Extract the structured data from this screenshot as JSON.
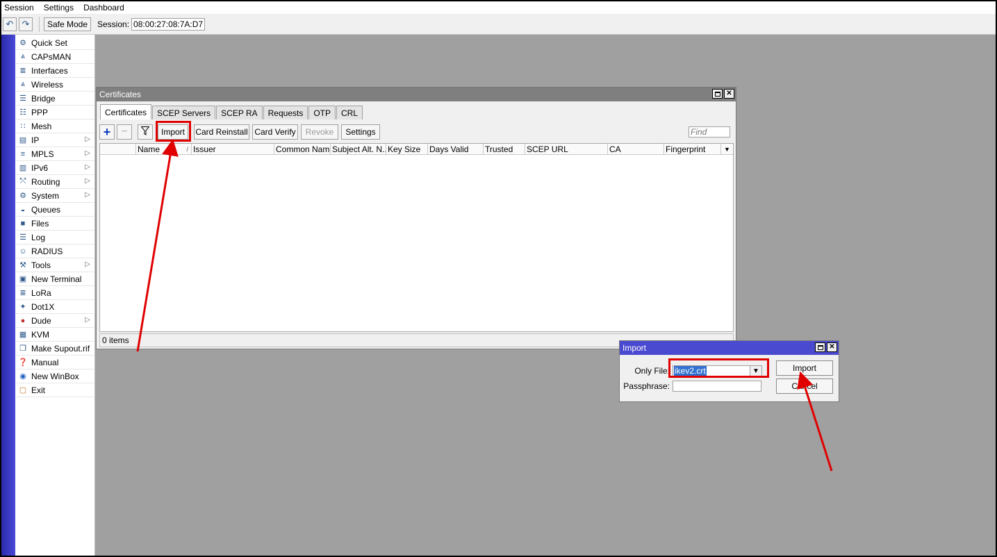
{
  "menubar": [
    "Session",
    "Settings",
    "Dashboard"
  ],
  "toolbar": {
    "undo_icon": "undo-icon",
    "redo_icon": "redo-icon",
    "safe_mode": "Safe Mode",
    "session_label": "Session:",
    "session_value": "08:00:27:08:7A:D7"
  },
  "leftmenu": [
    {
      "label": "Quick Set",
      "icon": "quick-set-icon",
      "submenu": false
    },
    {
      "label": "CAPsMAN",
      "icon": "capsman-icon",
      "submenu": false
    },
    {
      "label": "Interfaces",
      "icon": "interfaces-icon",
      "submenu": false
    },
    {
      "label": "Wireless",
      "icon": "wireless-icon",
      "submenu": false
    },
    {
      "label": "Bridge",
      "icon": "bridge-icon",
      "submenu": false
    },
    {
      "label": "PPP",
      "icon": "ppp-icon",
      "submenu": false
    },
    {
      "label": "Mesh",
      "icon": "mesh-icon",
      "submenu": false
    },
    {
      "label": "IP",
      "icon": "ip-icon",
      "submenu": true
    },
    {
      "label": "MPLS",
      "icon": "mpls-icon",
      "submenu": true
    },
    {
      "label": "IPv6",
      "icon": "ipv6-icon",
      "submenu": true
    },
    {
      "label": "Routing",
      "icon": "routing-icon",
      "submenu": true
    },
    {
      "label": "System",
      "icon": "system-icon",
      "submenu": true
    },
    {
      "label": "Queues",
      "icon": "queues-icon",
      "submenu": false
    },
    {
      "label": "Files",
      "icon": "files-icon",
      "submenu": false
    },
    {
      "label": "Log",
      "icon": "log-icon",
      "submenu": false
    },
    {
      "label": "RADIUS",
      "icon": "radius-icon",
      "submenu": false
    },
    {
      "label": "Tools",
      "icon": "tools-icon",
      "submenu": true
    },
    {
      "label": "New Terminal",
      "icon": "terminal-icon",
      "submenu": false
    },
    {
      "label": "LoRa",
      "icon": "lora-icon",
      "submenu": false
    },
    {
      "label": "Dot1X",
      "icon": "dot1x-icon",
      "submenu": false
    },
    {
      "label": "Dude",
      "icon": "dude-icon",
      "submenu": true
    },
    {
      "label": "KVM",
      "icon": "kvm-icon",
      "submenu": false
    },
    {
      "label": "Make Supout.rif",
      "icon": "supout-icon",
      "submenu": false
    },
    {
      "label": "Manual",
      "icon": "manual-icon",
      "submenu": false
    },
    {
      "label": "New WinBox",
      "icon": "winbox-icon",
      "submenu": false
    },
    {
      "label": "Exit",
      "icon": "exit-icon",
      "submenu": false
    }
  ],
  "certificates": {
    "title": "Certificates",
    "tabs": [
      "Certificates",
      "SCEP Servers",
      "SCEP RA",
      "Requests",
      "OTP",
      "CRL"
    ],
    "active_tab": 0,
    "buttons": {
      "import": "Import",
      "card_reinstall": "Card Reinstall",
      "card_verify": "Card Verify",
      "revoke": "Revoke",
      "settings": "Settings"
    },
    "find_placeholder": "Find",
    "columns": [
      "Name",
      "Issuer",
      "Common Name",
      "Subject Alt. N...",
      "Key Size",
      "Days Valid",
      "Trusted",
      "SCEP URL",
      "CA",
      "Fingerprint"
    ],
    "sort_indicator": "/",
    "status": "0 items"
  },
  "import_dialog": {
    "title": "Import",
    "only_file_label": "Only File:",
    "only_file_value": "ikev2.crt",
    "passphrase_label": "Passphrase:",
    "passphrase_value": "",
    "import_button": "Import",
    "cancel_button": "Cancel"
  },
  "colors": {
    "annotation": "#e00000",
    "active_title": "#4a4ad0",
    "inactive_title": "#7f7f7f",
    "desktop": "#a0a0a0"
  }
}
